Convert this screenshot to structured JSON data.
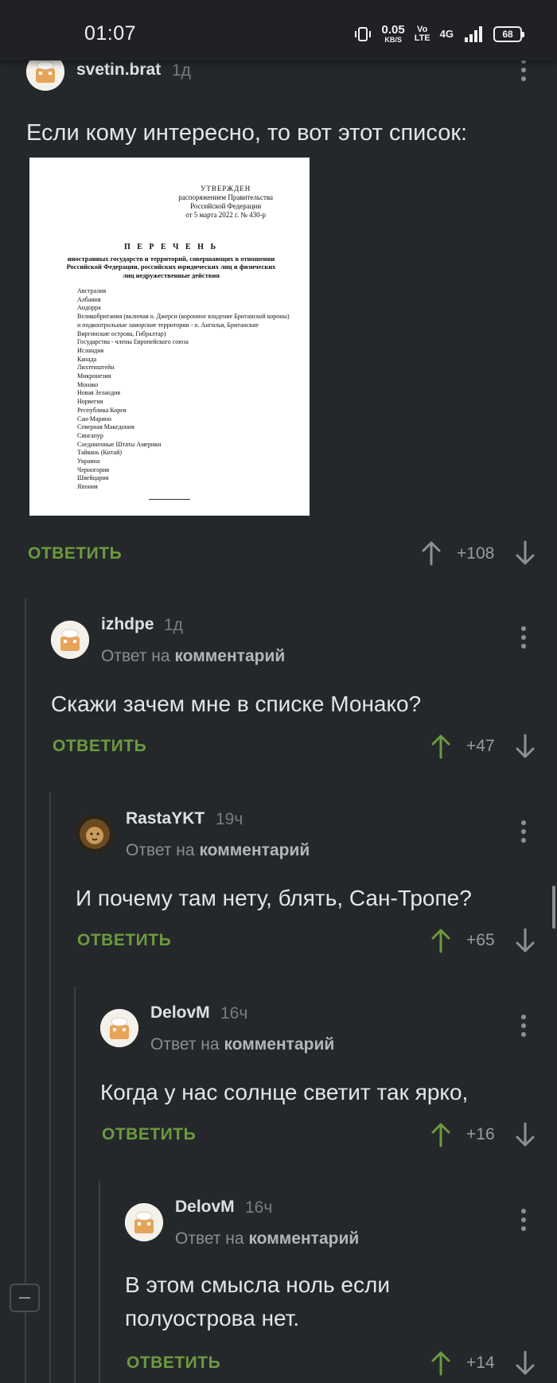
{
  "status_bar": {
    "time": "01:07",
    "speed_value": "0.05",
    "speed_unit": "KB/S",
    "volte_top": "Vo",
    "volte_bottom": "LTE",
    "network": "4G",
    "battery": "68"
  },
  "comments": [
    {
      "username": "svetin.brat",
      "time": "1д",
      "text": "Если кому интересно, то вот этот список:",
      "reply_label": "ОТВЕТИТЬ",
      "score": "+108",
      "attachment": {
        "approved_title": "УТВЕРЖДЕН",
        "approved_line1": "распоряжением Правительства",
        "approved_line2": "Российской Федерации",
        "approved_line3": "от 5 марта 2022 г.  № 430-р",
        "list_heading": "П Е Р Е Ч Е Н Ь",
        "list_subheading": "иностранных государств и территорий, совершающих в отношении Российской Федерации, российских юридических лиц и физических лиц недружественные действия",
        "items": [
          "Австралия",
          "Албания",
          "Андорра",
          "Великобритания (включая о. Джерси (коронное владение Британской короны) и подконтрольные заморские территории - о. Ангилья, Британские Виргинские острова, Гибралтар)",
          "Государства - члены Европейского союза",
          "Исландия",
          "Канада",
          "Лихтенштейн",
          "Микронезия",
          "Монако",
          "Новая Зеландия",
          "Норвегия",
          "Республика Корея",
          "Сан-Марино",
          "Северная Македония",
          "Сингапур",
          "Соединенные Штаты Америки",
          "Тайвань (Китай)",
          "Украина",
          "Черногория",
          "Швейцария",
          "Япония"
        ]
      }
    },
    {
      "username": "izhdpe",
      "time": "1д",
      "reply_prefix": "Ответ на",
      "reply_target": "комментарий",
      "text": "Скажи зачем мне в списке Монако?",
      "reply_label": "ОТВЕТИТЬ",
      "score": "+47"
    },
    {
      "username": "RastaYKT",
      "time": "19ч",
      "reply_prefix": "Ответ на",
      "reply_target": "комментарий",
      "text": "И почему там нету, блять, Сан-Тропе?",
      "reply_label": "ОТВЕТИТЬ",
      "score": "+65"
    },
    {
      "username": "DelovM",
      "time": "16ч",
      "reply_prefix": "Ответ на",
      "reply_target": "комментарий",
      "text": "Когда у нас солнце светит так ярко,",
      "reply_label": "ОТВЕТИТЬ",
      "score": "+16"
    },
    {
      "username": "DelovM",
      "time": "16ч",
      "reply_prefix": "Ответ на",
      "reply_target": "комментарий",
      "text_line1": "В этом смысла ноль если",
      "text_line2": "полуострова нет.",
      "reply_label": "ОТВЕТИТЬ",
      "score": "+14"
    }
  ],
  "colors": {
    "background": "#25282b",
    "accent_green": "#6c9a3f",
    "upvoted_arrow": "#6c9a3f",
    "neutral_arrow": "#8e9194"
  }
}
